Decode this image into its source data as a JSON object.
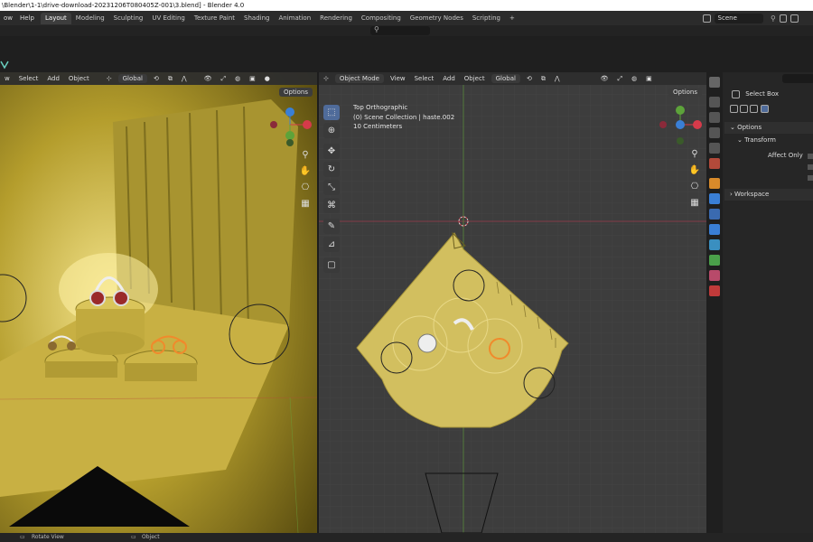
{
  "window": {
    "title": "\\Blender\\1-1\\drive-download-20231206T080405Z-001\\3.blend] - Blender 4.0"
  },
  "menu": {
    "items": [
      "ow",
      "Help"
    ]
  },
  "workspace_tabs": [
    "Layout",
    "Modeling",
    "Sculpting",
    "UV Editing",
    "Texture Paint",
    "Shading",
    "Animation",
    "Rendering",
    "Compositing",
    "Geometry Nodes",
    "Scripting",
    "+"
  ],
  "scene": {
    "name": "Scene"
  },
  "left_viewport": {
    "header": {
      "menu": [
        "w",
        "Select",
        "Add",
        "Object"
      ],
      "orientation": "Global"
    },
    "options_label": "Options"
  },
  "right_viewport": {
    "header": {
      "mode": "Object Mode",
      "menu": [
        "View",
        "Select",
        "Add",
        "Object"
      ],
      "orientation": "Global"
    },
    "options_label": "Options",
    "view_info": {
      "view_name": "Top Orthographic",
      "collection": "(0) Scene Collection | haste.002",
      "scale": "10 Centimeters"
    }
  },
  "properties": {
    "tool_name": "Select Box",
    "options_label": "Options",
    "transform_label": "Transform",
    "affect_only_label": "Affect Only",
    "workspace_label": "Workspace"
  },
  "statusbar": {
    "left": "Rotate View",
    "middle": "Object"
  },
  "colors": {
    "accent_blue": "#4f6b9a",
    "gold": "#c9b54f",
    "axis_red": "#d63a4a",
    "axis_green": "#5da33a",
    "axis_blue": "#3a7fd6"
  }
}
